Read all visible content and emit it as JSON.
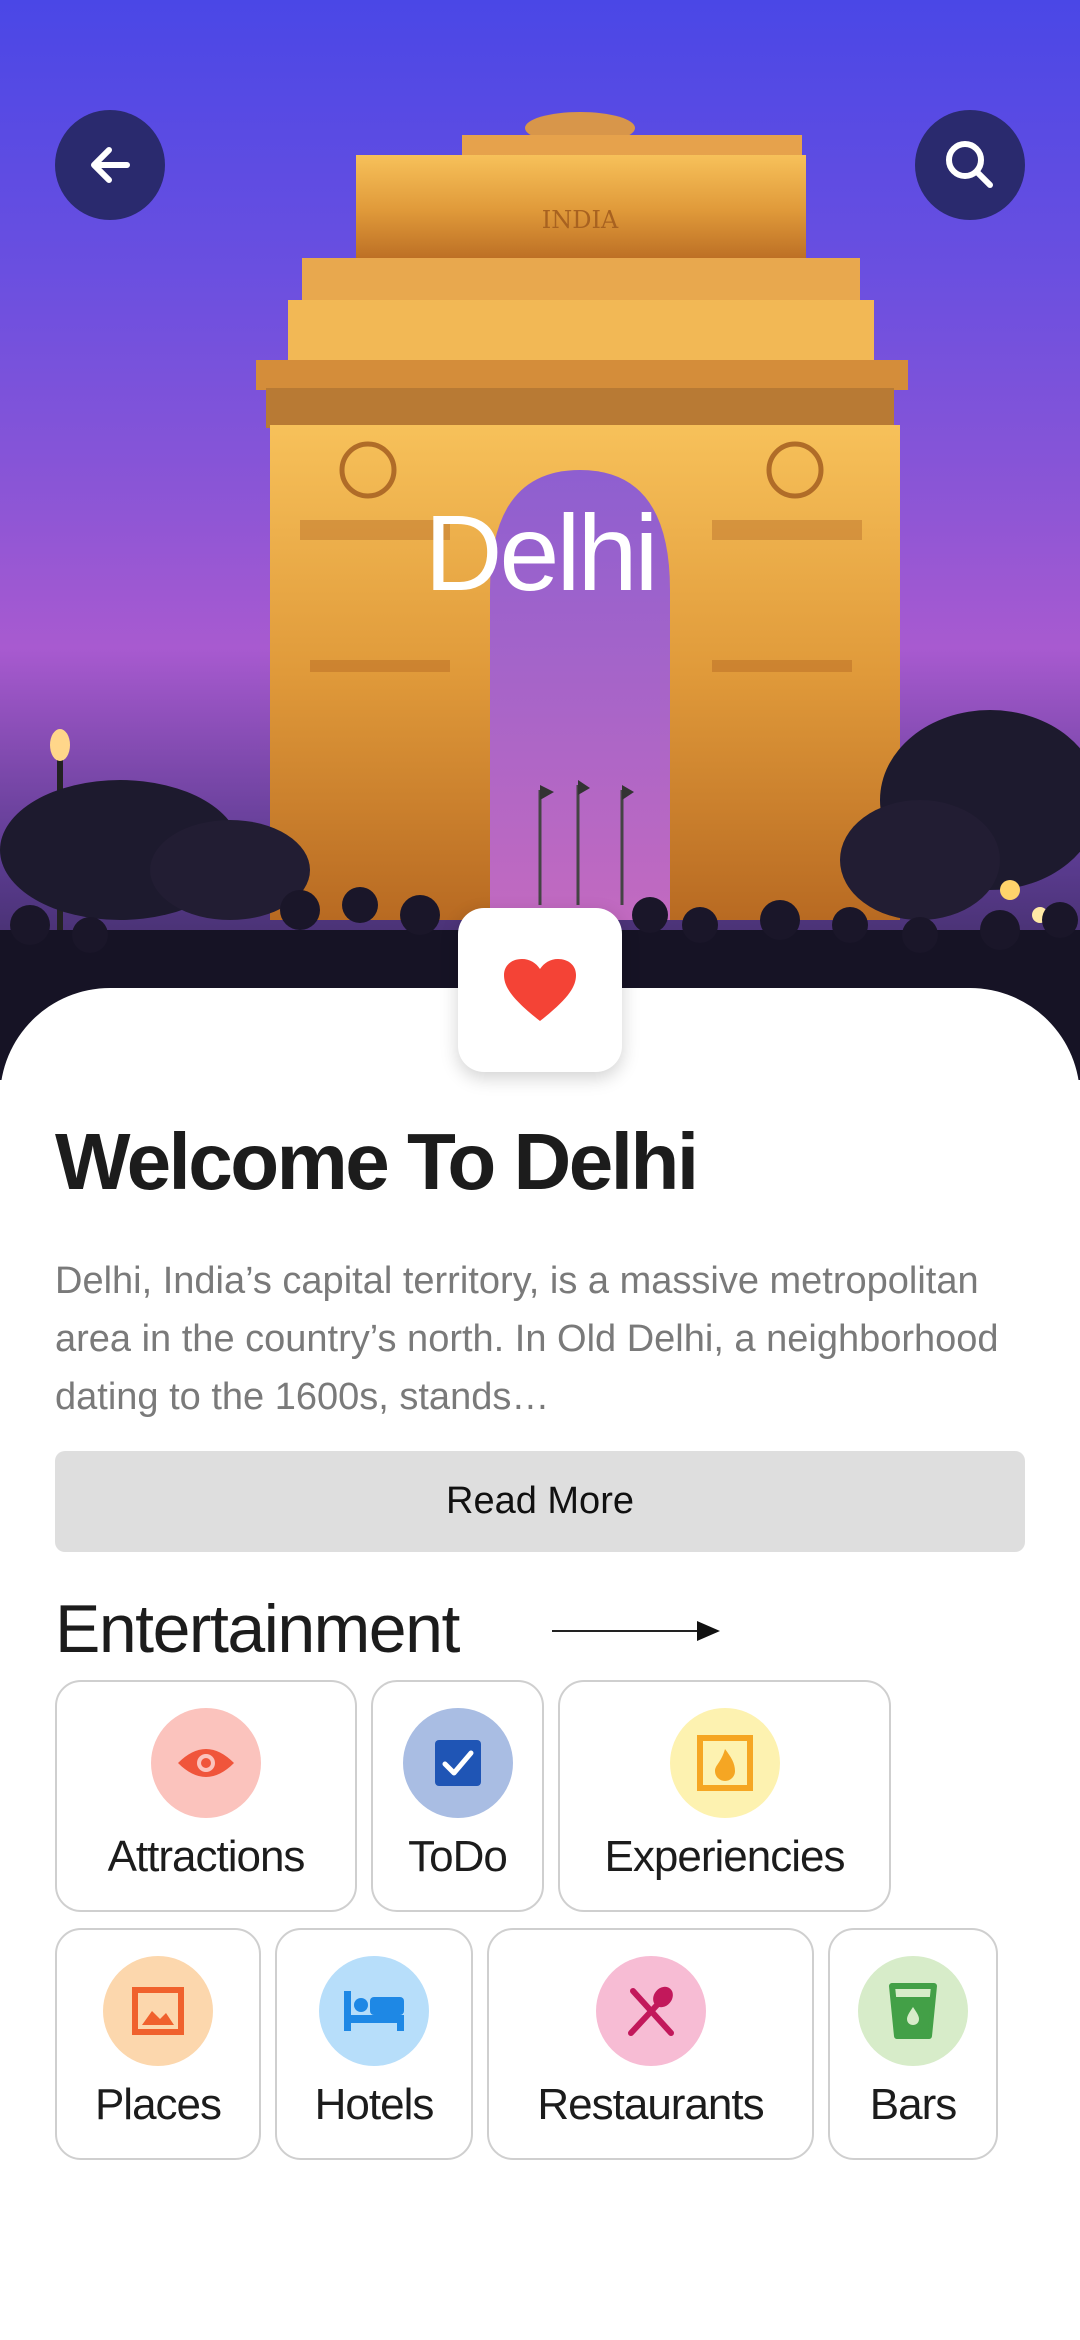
{
  "hero": {
    "city_name": "Delhi",
    "monument_inscription": "INDIA",
    "back_icon": "arrow-left-icon",
    "search_icon": "search-icon",
    "favorite_icon": "heart-icon",
    "favorite_color": "#f44336"
  },
  "content": {
    "title": "Welcome To Delhi",
    "description": "Delhi, India’s capital territory, is a massive metropolitan area in the country’s north. In Old Delhi, a neighborhood dating to the 1600s, stands…",
    "read_more_label": "Read More"
  },
  "entertainment": {
    "title": "Entertainment",
    "arrow_icon": "arrow-right-icon",
    "categories": [
      {
        "label": "Attractions",
        "icon": "eye-icon",
        "bg": "#fbc3bd",
        "fg": "#f0553b"
      },
      {
        "label": "ToDo",
        "icon": "checkbox-icon",
        "bg": "#a9bde3",
        "fg": "#1f55b5"
      },
      {
        "label": "Experiencies",
        "icon": "fireplace-icon",
        "bg": "#fdf2b0",
        "fg": "#f5a623"
      },
      {
        "label": "Places",
        "icon": "image-icon",
        "bg": "#fcd7ad",
        "fg": "#f0612d"
      },
      {
        "label": "Hotels",
        "icon": "bed-icon",
        "bg": "#b7defa",
        "fg": "#1e88e5"
      },
      {
        "label": "Restaurants",
        "icon": "utensils-icon",
        "bg": "#f7bcd4",
        "fg": "#c2185b"
      },
      {
        "label": "Bars",
        "icon": "cup-icon",
        "bg": "#d7ecc9",
        "fg": "#43a047"
      }
    ]
  }
}
